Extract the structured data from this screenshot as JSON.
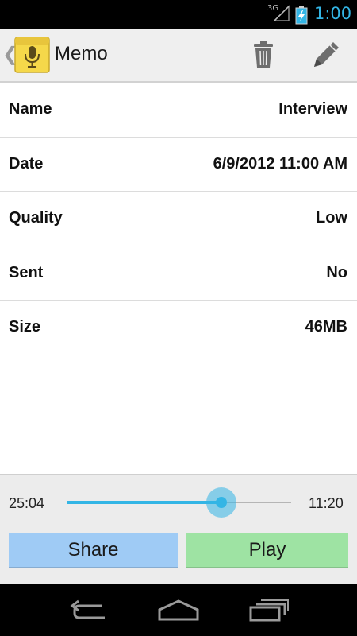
{
  "status_bar": {
    "network": "3G",
    "time": "1:00"
  },
  "action_bar": {
    "title": "Memo",
    "icons": [
      "back-chevron",
      "microphone-app-icon",
      "trash-icon",
      "pencil-icon"
    ]
  },
  "details": [
    {
      "label": "Name",
      "value": "Interview"
    },
    {
      "label": "Date",
      "value": "6/9/2012 11:00 AM"
    },
    {
      "label": "Quality",
      "value": "Low"
    },
    {
      "label": "Sent",
      "value": "No"
    },
    {
      "label": "Size",
      "value": "46MB"
    }
  ],
  "player": {
    "elapsed": "25:04",
    "remaining": "11:20",
    "progress": 0.69,
    "share_label": "Share",
    "play_label": "Play"
  },
  "colors": {
    "accent": "#33b5e5",
    "share_button": "#9fcbf5",
    "play_button": "#9ee3a3",
    "app_icon": "#f5d84a"
  }
}
